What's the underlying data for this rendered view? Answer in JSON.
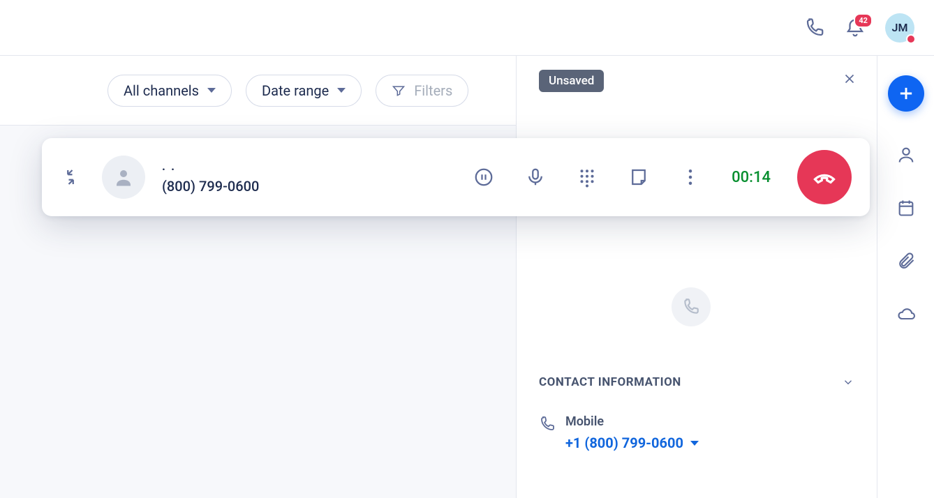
{
  "header": {
    "notification_count": "42",
    "avatar_initials": "JM"
  },
  "filters": {
    "channels_label": "All channels",
    "date_label": "Date range",
    "filters_label": "Filters"
  },
  "call": {
    "caller_name": ". .",
    "caller_number": "(800) 799-0600",
    "timer": "00:14"
  },
  "details": {
    "badge": "Unsaved",
    "section_title": "CONTACT INFORMATION",
    "mobile_label": "Mobile",
    "mobile_number": "+1 (800) 799-0600"
  }
}
